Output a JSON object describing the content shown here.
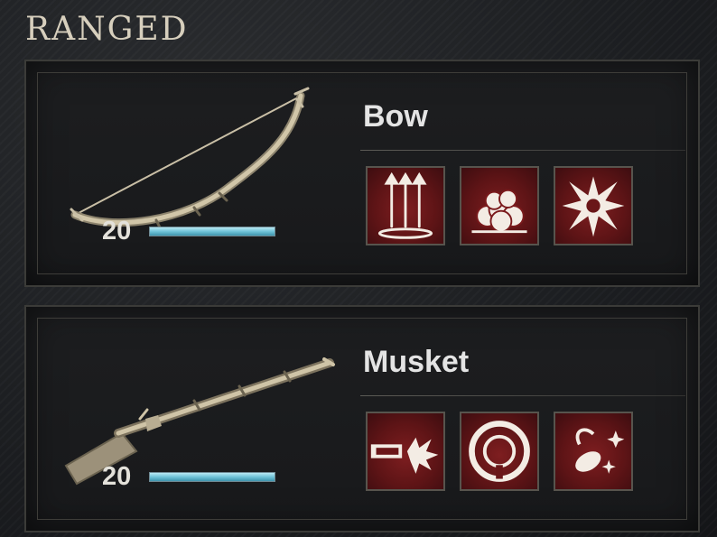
{
  "section": {
    "title": "RANGED"
  },
  "weapons": [
    {
      "name": "Bow",
      "level": "20",
      "progress": 1.0,
      "art_icon": "bow-icon",
      "abilities": [
        {
          "icon": "triple-arrows-icon"
        },
        {
          "icon": "smoke-cloud-icon"
        },
        {
          "icon": "explosion-burst-icon"
        }
      ]
    },
    {
      "name": "Musket",
      "level": "20",
      "progress": 1.0,
      "art_icon": "musket-icon",
      "abilities": [
        {
          "icon": "bullet-impact-icon"
        },
        {
          "icon": "target-ring-icon"
        },
        {
          "icon": "powder-sparkle-icon"
        }
      ]
    }
  ],
  "colors": {
    "ability_bg": "#6a1618",
    "bar_fill": "#6fc3d8",
    "title": "#d7cfbd"
  }
}
